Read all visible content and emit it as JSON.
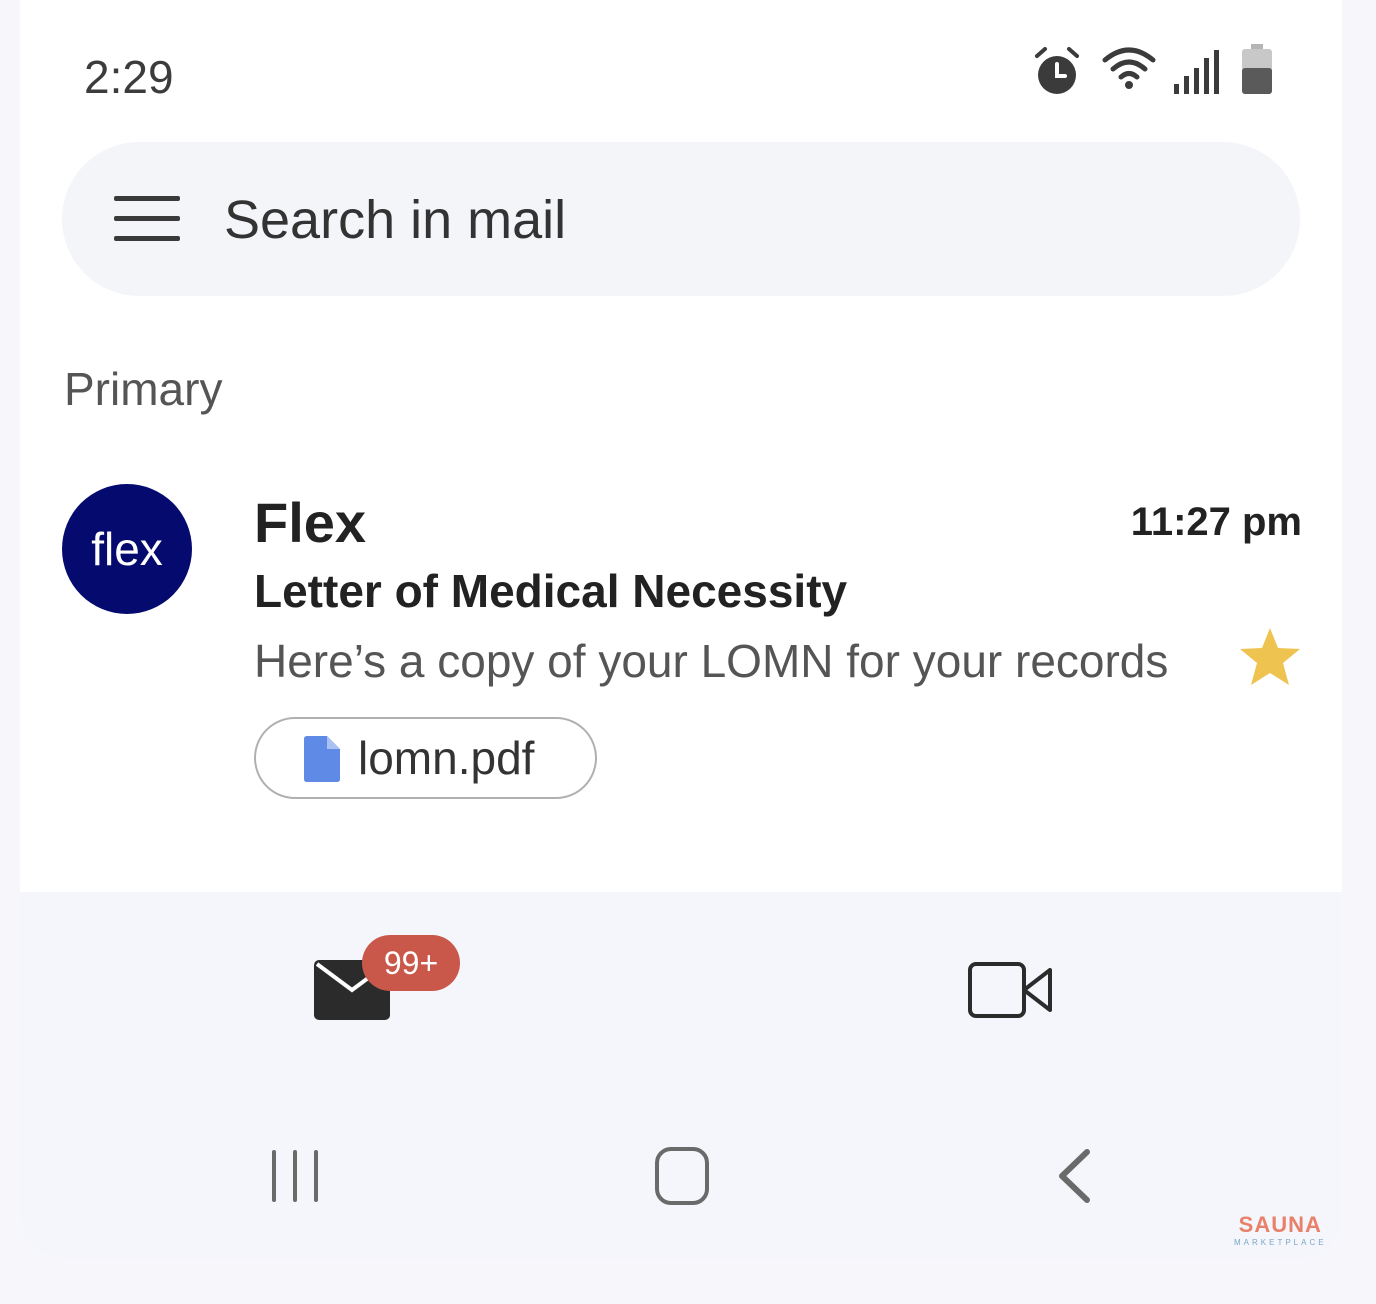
{
  "status_bar": {
    "time": "2:29",
    "icons": [
      "alarm-icon",
      "wifi-icon",
      "signal-icon",
      "battery-icon"
    ]
  },
  "search": {
    "placeholder": "Search in mail"
  },
  "section": {
    "label": "Primary"
  },
  "email": {
    "avatar_text": "flex",
    "avatar_color": "#050a6e",
    "sender": "Flex",
    "time": "11:27 pm",
    "subject": "Letter of Medical Necessity",
    "snippet": "Here’s a copy of your LOMN for your records",
    "starred": true,
    "star_color": "#efc350",
    "attachment": {
      "name": "lomn.pdf",
      "icon": "file-icon",
      "icon_color": "#5f8ae6"
    }
  },
  "bottom_nav": {
    "mail_badge": "99+",
    "badge_color": "#c9584b",
    "tabs": [
      "mail-icon",
      "video-camera-icon"
    ]
  },
  "system_nav": [
    "recent-apps-icon",
    "home-icon",
    "back-icon"
  ],
  "watermark": {
    "brand": "SAUNA",
    "sub": "MARKETPLACE"
  }
}
